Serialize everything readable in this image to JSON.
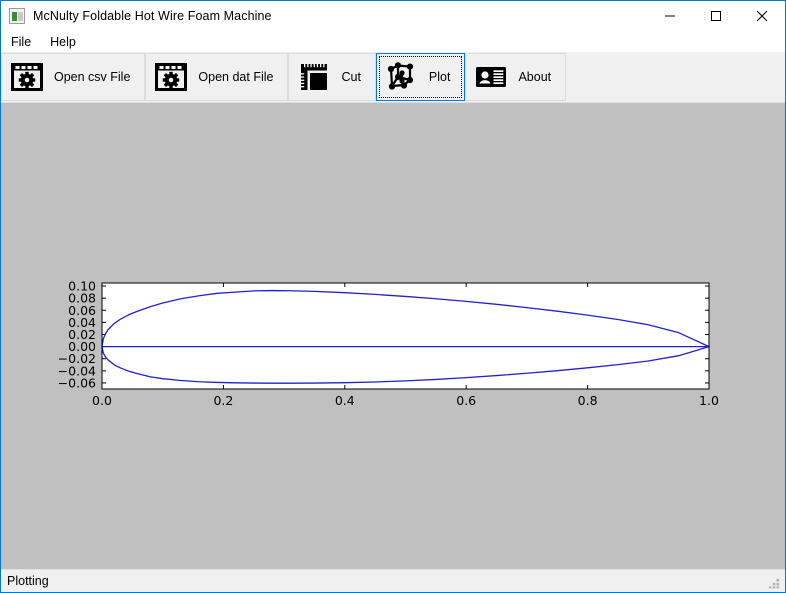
{
  "window": {
    "title": "McNulty Foldable Hot Wire Foam Machine",
    "icon": "app-window-icon",
    "accent_color": "#0078d7",
    "client_background": "#c0c0c0",
    "chrome_background": "#f0f0f0",
    "caption_buttons": [
      {
        "name": "minimize",
        "glyph": "—"
      },
      {
        "name": "maximize",
        "glyph": "□"
      },
      {
        "name": "close",
        "glyph": "✕"
      }
    ]
  },
  "menubar": {
    "items": [
      {
        "label": "File"
      },
      {
        "label": "Help"
      }
    ]
  },
  "toolbar": {
    "buttons": [
      {
        "label": "Open csv File",
        "icon": "window-gear-icon",
        "selected": false
      },
      {
        "label": "Open dat File",
        "icon": "window-gear-icon",
        "selected": false
      },
      {
        "label": "Cut",
        "icon": "ruler-square-icon",
        "selected": false
      },
      {
        "label": "Plot",
        "icon": "node-graph-icon",
        "selected": true
      },
      {
        "label": "About",
        "icon": "id-card-icon",
        "selected": false
      }
    ]
  },
  "statusbar": {
    "text": "Plotting",
    "grip": "resize-grip-icon"
  },
  "chart_data": {
    "type": "line",
    "title": "",
    "xlabel": "",
    "ylabel": "",
    "xlim": [
      0.0,
      1.0
    ],
    "ylim": [
      -0.07,
      0.105
    ],
    "grid": false,
    "legend": false,
    "line_color": "#2222cc",
    "background": "#ffffff",
    "figure_background": "#c0c0c0",
    "xticks": [
      0.0,
      0.2,
      0.4,
      0.6,
      0.8,
      1.0
    ],
    "xtick_labels": [
      "0.0",
      "0.2",
      "0.4",
      "0.6",
      "0.8",
      "1.0"
    ],
    "yticks": [
      -0.06,
      -0.04,
      -0.02,
      0.0,
      0.02,
      0.04,
      0.06,
      0.08,
      0.1
    ],
    "ytick_labels": [
      "-0.06",
      "-0.04",
      "-0.02",
      "0.00",
      "0.02",
      "0.04",
      "0.06",
      "0.08",
      "0.10"
    ],
    "series": [
      {
        "name": "upper-surface",
        "x": [
          0.0,
          0.002,
          0.005,
          0.01,
          0.02,
          0.03,
          0.045,
          0.06,
          0.08,
          0.1,
          0.13,
          0.16,
          0.19,
          0.22,
          0.25,
          0.28,
          0.31,
          0.35,
          0.4,
          0.45,
          0.5,
          0.55,
          0.6,
          0.65,
          0.7,
          0.75,
          0.8,
          0.85,
          0.9,
          0.95,
          1.0
        ],
        "y": [
          0.0,
          0.012,
          0.02,
          0.028,
          0.038,
          0.045,
          0.053,
          0.059,
          0.066,
          0.072,
          0.079,
          0.084,
          0.088,
          0.09,
          0.092,
          0.0925,
          0.0922,
          0.0912,
          0.089,
          0.0862,
          0.0828,
          0.079,
          0.0746,
          0.0698,
          0.0644,
          0.0585,
          0.052,
          0.0448,
          0.036,
          0.023,
          0.0
        ]
      },
      {
        "name": "lower-surface",
        "x": [
          0.0,
          0.002,
          0.005,
          0.01,
          0.02,
          0.03,
          0.045,
          0.06,
          0.08,
          0.1,
          0.13,
          0.16,
          0.19,
          0.22,
          0.25,
          0.28,
          0.31,
          0.35,
          0.4,
          0.45,
          0.5,
          0.55,
          0.6,
          0.65,
          0.7,
          0.75,
          0.8,
          0.85,
          0.9,
          0.95,
          1.0
        ],
        "y": [
          0.0,
          -0.01,
          -0.016,
          -0.022,
          -0.03,
          -0.035,
          -0.041,
          -0.045,
          -0.05,
          -0.053,
          -0.056,
          -0.058,
          -0.0592,
          -0.0598,
          -0.0602,
          -0.0604,
          -0.0604,
          -0.0602,
          -0.0596,
          -0.0584,
          -0.0566,
          -0.0542,
          -0.0512,
          -0.0478,
          -0.044,
          -0.0398,
          -0.035,
          -0.0298,
          -0.0238,
          -0.015,
          0.0
        ]
      },
      {
        "name": "chord-line",
        "x": [
          0.0,
          1.0
        ],
        "y": [
          0.0,
          0.0
        ]
      }
    ]
  }
}
